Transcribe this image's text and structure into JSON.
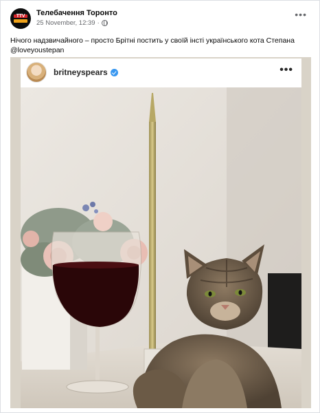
{
  "post": {
    "page_name": "Телебачення Торонто",
    "avatar_text": "TTV",
    "timestamp": "25 November, 12:39",
    "separator": "·",
    "caption": "Нічого надзвичайного – просто Брітні постить у своїй інсті українського кота Степана @loveyoustepan",
    "more_label": "•••"
  },
  "instagram": {
    "username": "britneyspears",
    "more_label": "•••"
  },
  "colors": {
    "background": "#ffffff",
    "meta_text": "#65676b",
    "verified": "#3897f0"
  }
}
